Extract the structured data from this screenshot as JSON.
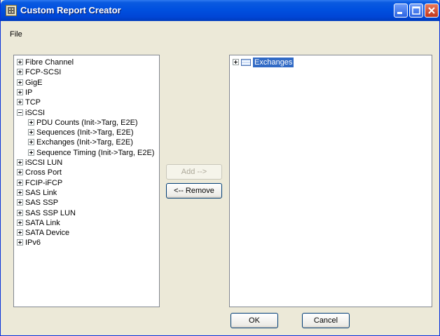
{
  "window": {
    "title": "Custom Report Creator"
  },
  "menu": {
    "file": "File"
  },
  "left_tree": [
    {
      "label": "Fibre Channel",
      "expanded": false,
      "level": 0
    },
    {
      "label": "FCP-SCSI",
      "expanded": false,
      "level": 0
    },
    {
      "label": "GigE",
      "expanded": false,
      "level": 0
    },
    {
      "label": "IP",
      "expanded": false,
      "level": 0
    },
    {
      "label": "TCP",
      "expanded": false,
      "level": 0
    },
    {
      "label": "iSCSI",
      "expanded": true,
      "level": 0
    },
    {
      "label": "PDU Counts (Init->Targ, E2E)",
      "expanded": false,
      "level": 1
    },
    {
      "label": "Sequences (Init->Targ, E2E)",
      "expanded": false,
      "level": 1
    },
    {
      "label": "Exchanges (Init->Targ, E2E)",
      "expanded": false,
      "level": 1
    },
    {
      "label": "Sequence Timing (Init->Targ, E2E)",
      "expanded": false,
      "level": 1
    },
    {
      "label": "iSCSI LUN",
      "expanded": false,
      "level": 0
    },
    {
      "label": "Cross Port",
      "expanded": false,
      "level": 0
    },
    {
      "label": "FCIP-iFCP",
      "expanded": false,
      "level": 0
    },
    {
      "label": "SAS Link",
      "expanded": false,
      "level": 0
    },
    {
      "label": "SAS SSP",
      "expanded": false,
      "level": 0
    },
    {
      "label": "SAS SSP LUN",
      "expanded": false,
      "level": 0
    },
    {
      "label": "SATA Link",
      "expanded": false,
      "level": 0
    },
    {
      "label": "SATA Device",
      "expanded": false,
      "level": 0
    },
    {
      "label": "IPv6",
      "expanded": false,
      "level": 0
    }
  ],
  "right_tree": [
    {
      "label": "Exchanges",
      "selected": true
    }
  ],
  "buttons": {
    "add": "Add -->",
    "remove": "<-- Remove",
    "ok": "OK",
    "cancel": "Cancel"
  },
  "colors": {
    "titlebar": "#0050df",
    "selection": "#316ac5",
    "background": "#ece9d8"
  }
}
